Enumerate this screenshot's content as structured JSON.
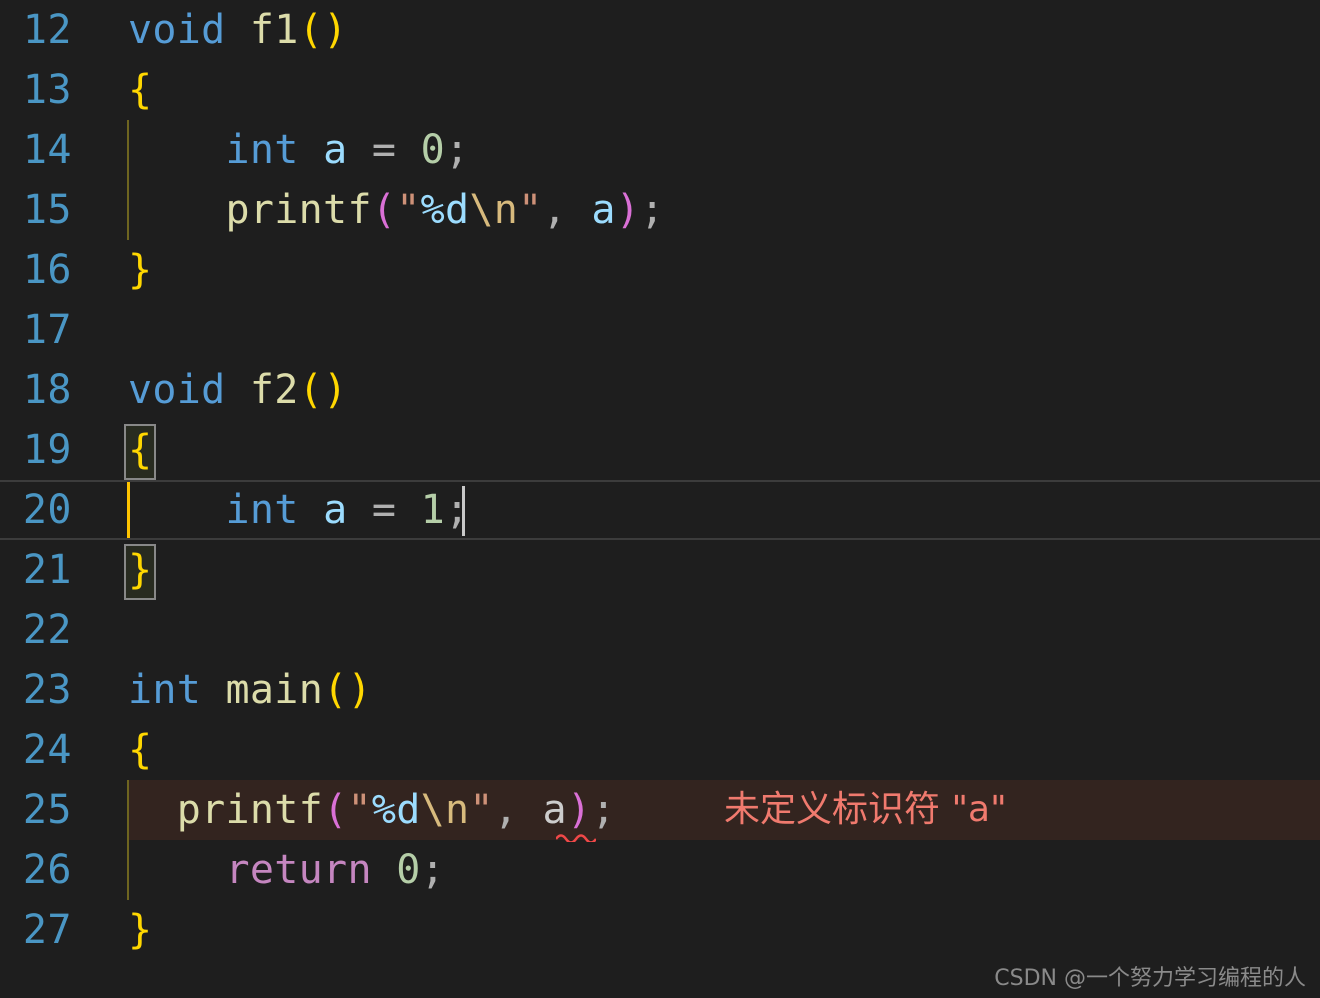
{
  "editor": {
    "background_color": "#1e1e1e",
    "line_number_color": "#4a96c4",
    "line_height_px": 60,
    "first_visible_line": 12,
    "last_visible_line": 27,
    "language": "c"
  },
  "cursor": {
    "line": 20,
    "column": 14,
    "color": "#c8c8c8"
  },
  "lines": [
    {
      "number": "12",
      "text": "void f1()"
    },
    {
      "number": "13",
      "text": "{"
    },
    {
      "number": "14",
      "text": "    int a = 0;"
    },
    {
      "number": "15",
      "text": "    printf(\"%d\\n\", a);"
    },
    {
      "number": "16",
      "text": "}"
    },
    {
      "number": "17",
      "text": ""
    },
    {
      "number": "18",
      "text": "void f2()"
    },
    {
      "number": "19",
      "text": "{"
    },
    {
      "number": "20",
      "text": "    int a = 1;"
    },
    {
      "number": "21",
      "text": "}"
    },
    {
      "number": "22",
      "text": ""
    },
    {
      "number": "23",
      "text": "int main()"
    },
    {
      "number": "24",
      "text": "{"
    },
    {
      "number": "25",
      "text": "  printf(\"%d\\n\", a);"
    },
    {
      "number": "26",
      "text": "    return 0;"
    },
    {
      "number": "27",
      "text": "}"
    }
  ],
  "tokens": {
    "void": "void",
    "int": "int",
    "f1": "f1",
    "f2": "f2",
    "main": "main",
    "printf": "printf",
    "return": "return",
    "paren_open": "(",
    "paren_close": ")",
    "brace_open": "{",
    "brace_close": "}",
    "semicolon": ";",
    "comma": ",",
    "equals": "=",
    "var_a": "a",
    "num_0": "0",
    "num_1": "1",
    "quote": "\"",
    "format_d": "%d",
    "escape_n": "\\n",
    "space": " ",
    "indent4": "    ",
    "indent2": "  "
  },
  "diagnostic": {
    "line": 25,
    "message": "未定义标识符 \"a\"",
    "severity": "error",
    "message_color": "#f07a6e",
    "line_background_color": "#33241f",
    "squiggle_color": "#f04848",
    "underlined_token": "a"
  },
  "colors": {
    "keyword": "#569cd6",
    "function": "#dcdcaa",
    "paren_yellow": "#ffd700",
    "paren_magenta": "#da70d6",
    "brace": "#ffd700",
    "variable": "#9cdcfe",
    "variable_unresolved": "#cccccc",
    "operator": "#b0b0b0",
    "number": "#b5cea8",
    "string": "#ce9178",
    "format_specifier": "#9cdcfe",
    "escape": "#d7ba7d",
    "return_keyword": "#c586c0",
    "indent_guide": "#6e6520",
    "indent_guide_active": "#ffc400",
    "bracket_match_border": "#888888"
  },
  "watermark": {
    "text": "CSDN @一个努力学习编程的人"
  }
}
